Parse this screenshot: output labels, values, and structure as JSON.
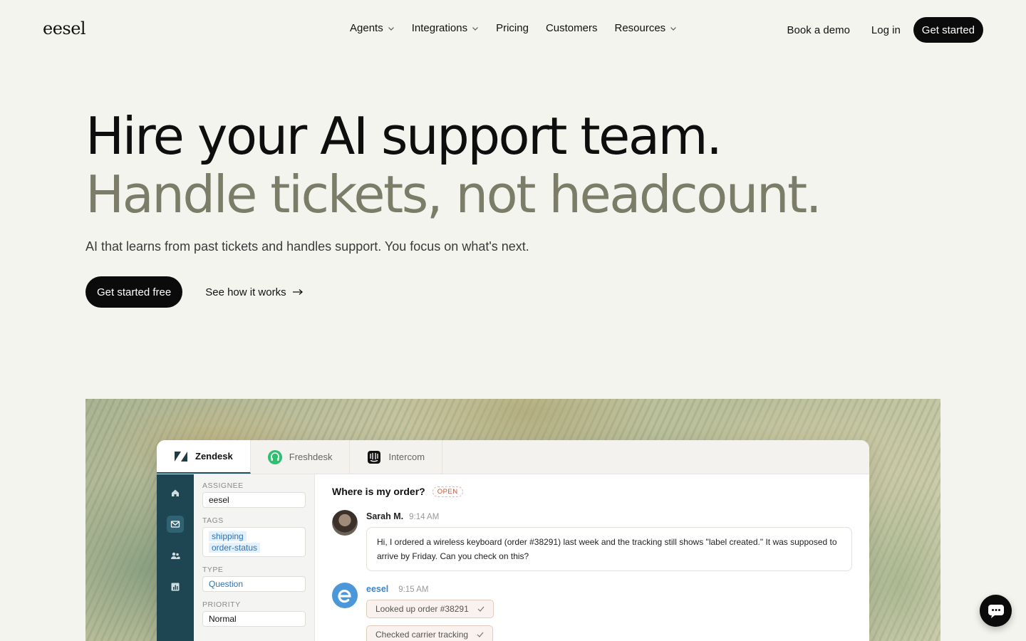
{
  "nav": {
    "logo": "eesel",
    "items": [
      {
        "label": "Agents",
        "dropdown": true
      },
      {
        "label": "Integrations",
        "dropdown": true
      },
      {
        "label": "Pricing",
        "dropdown": false
      },
      {
        "label": "Customers",
        "dropdown": false
      },
      {
        "label": "Resources",
        "dropdown": true
      }
    ],
    "book_demo": "Book a demo",
    "login": "Log in",
    "get_started": "Get started"
  },
  "hero": {
    "line1": "Hire your AI support team.",
    "line2": "Handle tickets, not headcount.",
    "subtitle": "AI that learns from past tickets and handles support. You focus on what's next.",
    "cta_primary": "Get started free",
    "cta_secondary": "See how it works",
    "line2_color": "#7b7d69"
  },
  "demo": {
    "tabs": [
      {
        "label": "Zendesk",
        "icon": "zendesk-logo-icon",
        "active": true
      },
      {
        "label": "Freshdesk",
        "icon": "freshdesk-logo-icon",
        "active": false
      },
      {
        "label": "Intercom",
        "icon": "intercom-logo-icon",
        "active": false
      }
    ],
    "rail_icons": [
      "home-icon",
      "inbox-icon",
      "users-icon",
      "chart-icon"
    ],
    "fields": {
      "assignee_label": "ASSIGNEE",
      "assignee": "eesel",
      "tags_label": "TAGS",
      "tags": [
        "shipping",
        "order-status"
      ],
      "type_label": "TYPE",
      "type": "Question",
      "priority_label": "PRIORITY",
      "priority": "Normal"
    },
    "ticket": {
      "subject": "Where is my order?",
      "status": "OPEN",
      "customer_name": "Sarah M.",
      "customer_time": "9:14 AM",
      "customer_message": "Hi, I ordered a wireless keyboard (order #38291) last week and the tracking still shows \"label created.\" It was supposed to arrive by Friday. Can you check on this?",
      "agent_name": "eesel",
      "agent_time": "9:15 AM",
      "steps": [
        "Looked up order #38291",
        "Checked carrier tracking"
      ]
    },
    "accent": "#1e4652"
  }
}
